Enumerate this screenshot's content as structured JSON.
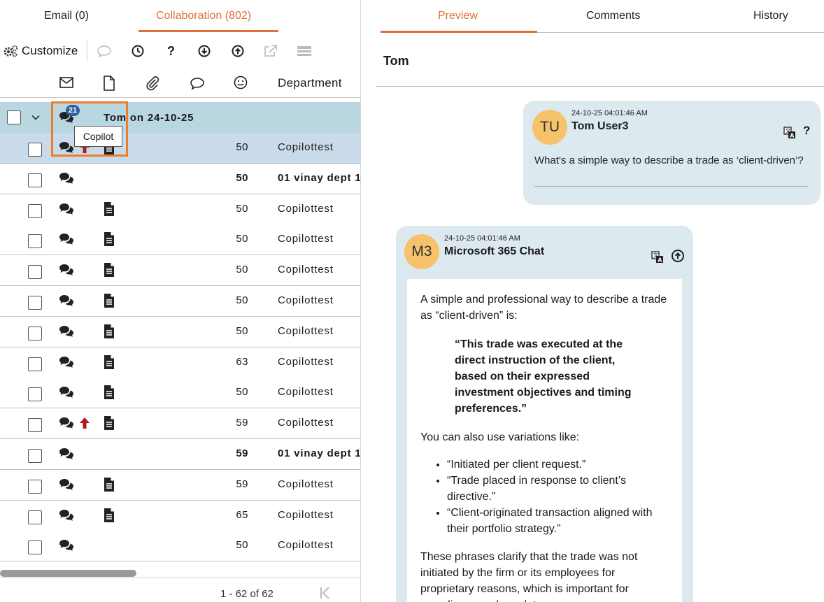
{
  "tabs": {
    "email": "Email (0)",
    "collaboration": "Collaboration (802)"
  },
  "toolbar": {
    "customize": "Customize",
    "help": "?"
  },
  "columns": {
    "department": "Department"
  },
  "group": {
    "badge": "21",
    "title_part1": "Tom",
    "title_part2": " on 24-10-25"
  },
  "tooltip": "Copilot",
  "rows": [
    {
      "num": "50",
      "dept": "Copilottest"
    },
    {
      "num": "50",
      "dept": "01 vinay dept 1"
    },
    {
      "num": "50",
      "dept": "Copilottest"
    },
    {
      "num": "50",
      "dept": "Copilottest"
    },
    {
      "num": "50",
      "dept": "Copilottest"
    },
    {
      "num": "50",
      "dept": "Copilottest"
    },
    {
      "num": "50",
      "dept": "Copilottest"
    },
    {
      "num": "63",
      "dept": "Copilottest"
    },
    {
      "num": "50",
      "dept": "Copilottest"
    },
    {
      "num": "59",
      "dept": "Copilottest"
    },
    {
      "num": "59",
      "dept": "01 vinay dept 1"
    },
    {
      "num": "59",
      "dept": "Copilottest"
    },
    {
      "num": "65",
      "dept": "Copilottest"
    },
    {
      "num": "50",
      "dept": "Copilottest"
    }
  ],
  "pager": {
    "text": "1 - 62 of 62"
  },
  "right_tabs": {
    "preview": "Preview",
    "comments": "Comments",
    "history": "History"
  },
  "preview_title": "Tom",
  "messages": {
    "user": {
      "initials": "TU",
      "timestamp": "24-10-25 04:01:46 AM",
      "name": "Tom User3",
      "help": "?",
      "text": "What's a simple way to describe a trade as ‘client-driven’?"
    },
    "bot": {
      "initials": "M3",
      "timestamp": "24-10-25 04:01:46 AM",
      "name": "Microsoft 365 Chat",
      "intro": "A simple and professional way to describe a trade as “client-driven” is:",
      "quote": "“This trade was executed at the direct instruction of the client, based on their expressed investment objectives and timing preferences.”",
      "variations_intro": "You can also use variations like:",
      "variations": [
        "“Initiated per client request.”",
        "“Trade placed in response to client’s directive.”",
        "“Client-originated transaction aligned with their portfolio strategy.”"
      ],
      "closing": "These phrases clarify that the trade was not initiated by the firm or its employees for proprietary reasons, which is important for compliance and regulatory purposes."
    }
  },
  "colors": {
    "accent": "#e0703a",
    "group_row": "#b9d7e1",
    "selected_row": "#c9daea",
    "up_arrow": "#b0191e",
    "avatar": "#f6c26b",
    "bubble": "#dce9ef"
  }
}
